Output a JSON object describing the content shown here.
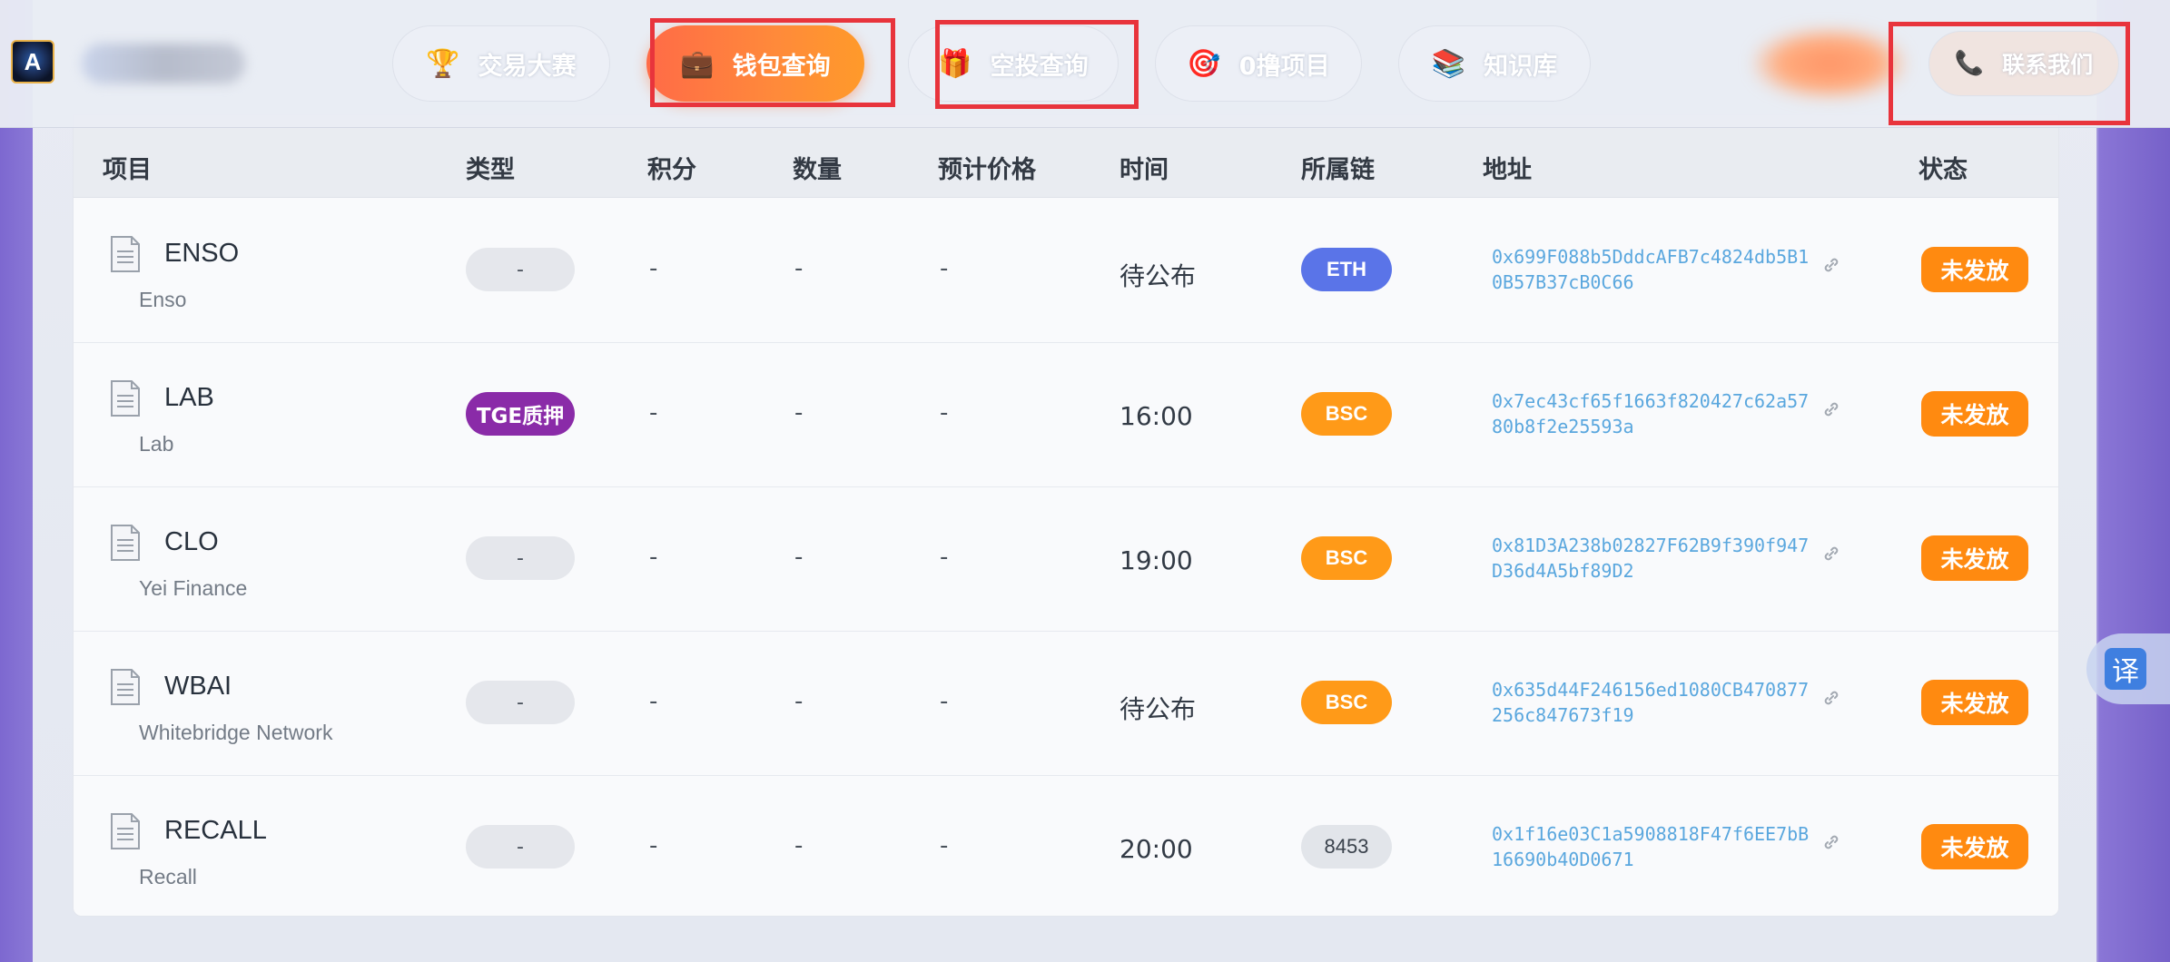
{
  "nav": {
    "logo_letter": "A",
    "items": [
      {
        "label": "交易大赛",
        "icon": "trophy-icon",
        "glyph": "🏆"
      },
      {
        "label": "钱包查询",
        "icon": "briefcase-icon",
        "glyph": "💼"
      },
      {
        "label": "空投查询",
        "icon": "gift-icon",
        "glyph": "🎁"
      },
      {
        "label": "0撸项目",
        "icon": "target-icon",
        "glyph": "🎯"
      },
      {
        "label": "知识库",
        "icon": "books-icon",
        "glyph": "📚"
      },
      {
        "label": "联系我们",
        "icon": "phone-icon",
        "glyph": "📞"
      }
    ],
    "active": "钱包查询"
  },
  "table": {
    "headers": [
      "项目",
      "类型",
      "积分",
      "数量",
      "预计价格",
      "时间",
      "所属链",
      "地址",
      "状态"
    ],
    "rows": [
      {
        "symbol": "ENSO",
        "name": "Enso",
        "type": "-",
        "points": "-",
        "amount": "-",
        "price": "-",
        "time": "待公布",
        "chain": "ETH",
        "address": "0x699F088b5DddcAFB7c4824db5B10B57B37cB0C66",
        "status": "未发放"
      },
      {
        "symbol": "LAB",
        "name": "Lab",
        "type": "TGE质押",
        "points": "-",
        "amount": "-",
        "price": "-",
        "time": "16:00",
        "chain": "BSC",
        "address": "0x7ec43cf65f1663f820427c62a5780b8f2e25593a",
        "status": "未发放"
      },
      {
        "symbol": "CLO",
        "name": "Yei Finance",
        "type": "-",
        "points": "-",
        "amount": "-",
        "price": "-",
        "time": "19:00",
        "chain": "BSC",
        "address": "0x81D3A238b02827F62B9f390f947D36d4A5bf89D2",
        "status": "未发放"
      },
      {
        "symbol": "WBAI",
        "name": "Whitebridge Network",
        "type": "-",
        "points": "-",
        "amount": "-",
        "price": "-",
        "time": "待公布",
        "chain": "BSC",
        "address": "0x635d44F246156ed1080CB470877256c847673f19",
        "status": "未发放"
      },
      {
        "symbol": "RECALL",
        "name": "Recall",
        "type": "-",
        "points": "-",
        "amount": "-",
        "price": "-",
        "time": "20:00",
        "chain": "8453",
        "address": "0x1f16e03C1a5908818F47f6EE7bB16690b40D0671",
        "status": "未发放"
      }
    ]
  },
  "translate_label": "译",
  "colors": {
    "accent_orange": "#ff8a10",
    "eth_blue": "#5a74e8",
    "tge_purple": "#8a2ba8",
    "address_blue": "#5aa7de",
    "highlight_red": "#e8343c"
  }
}
